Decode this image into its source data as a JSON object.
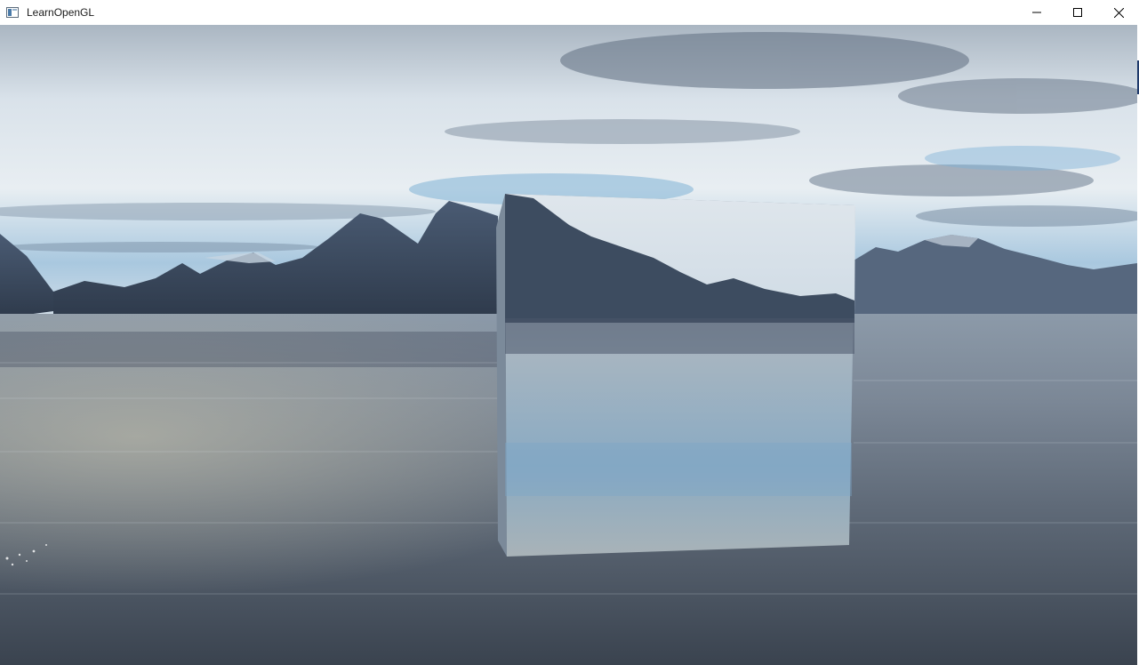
{
  "window": {
    "title": "LearnOpenGL",
    "icons": {
      "app": "app-window-icon",
      "minimize": "minimize-icon",
      "maximize": "maximize-icon",
      "close": "close-icon"
    }
  },
  "scene": {
    "description_colors": {
      "sky_top": "#a9b9c8",
      "sky_mid": "#dde6ee",
      "sky_blue": "#7fb2d6",
      "mountain": "#3e4f66",
      "water": "#6b7686",
      "water_dark": "#3d4655"
    }
  }
}
